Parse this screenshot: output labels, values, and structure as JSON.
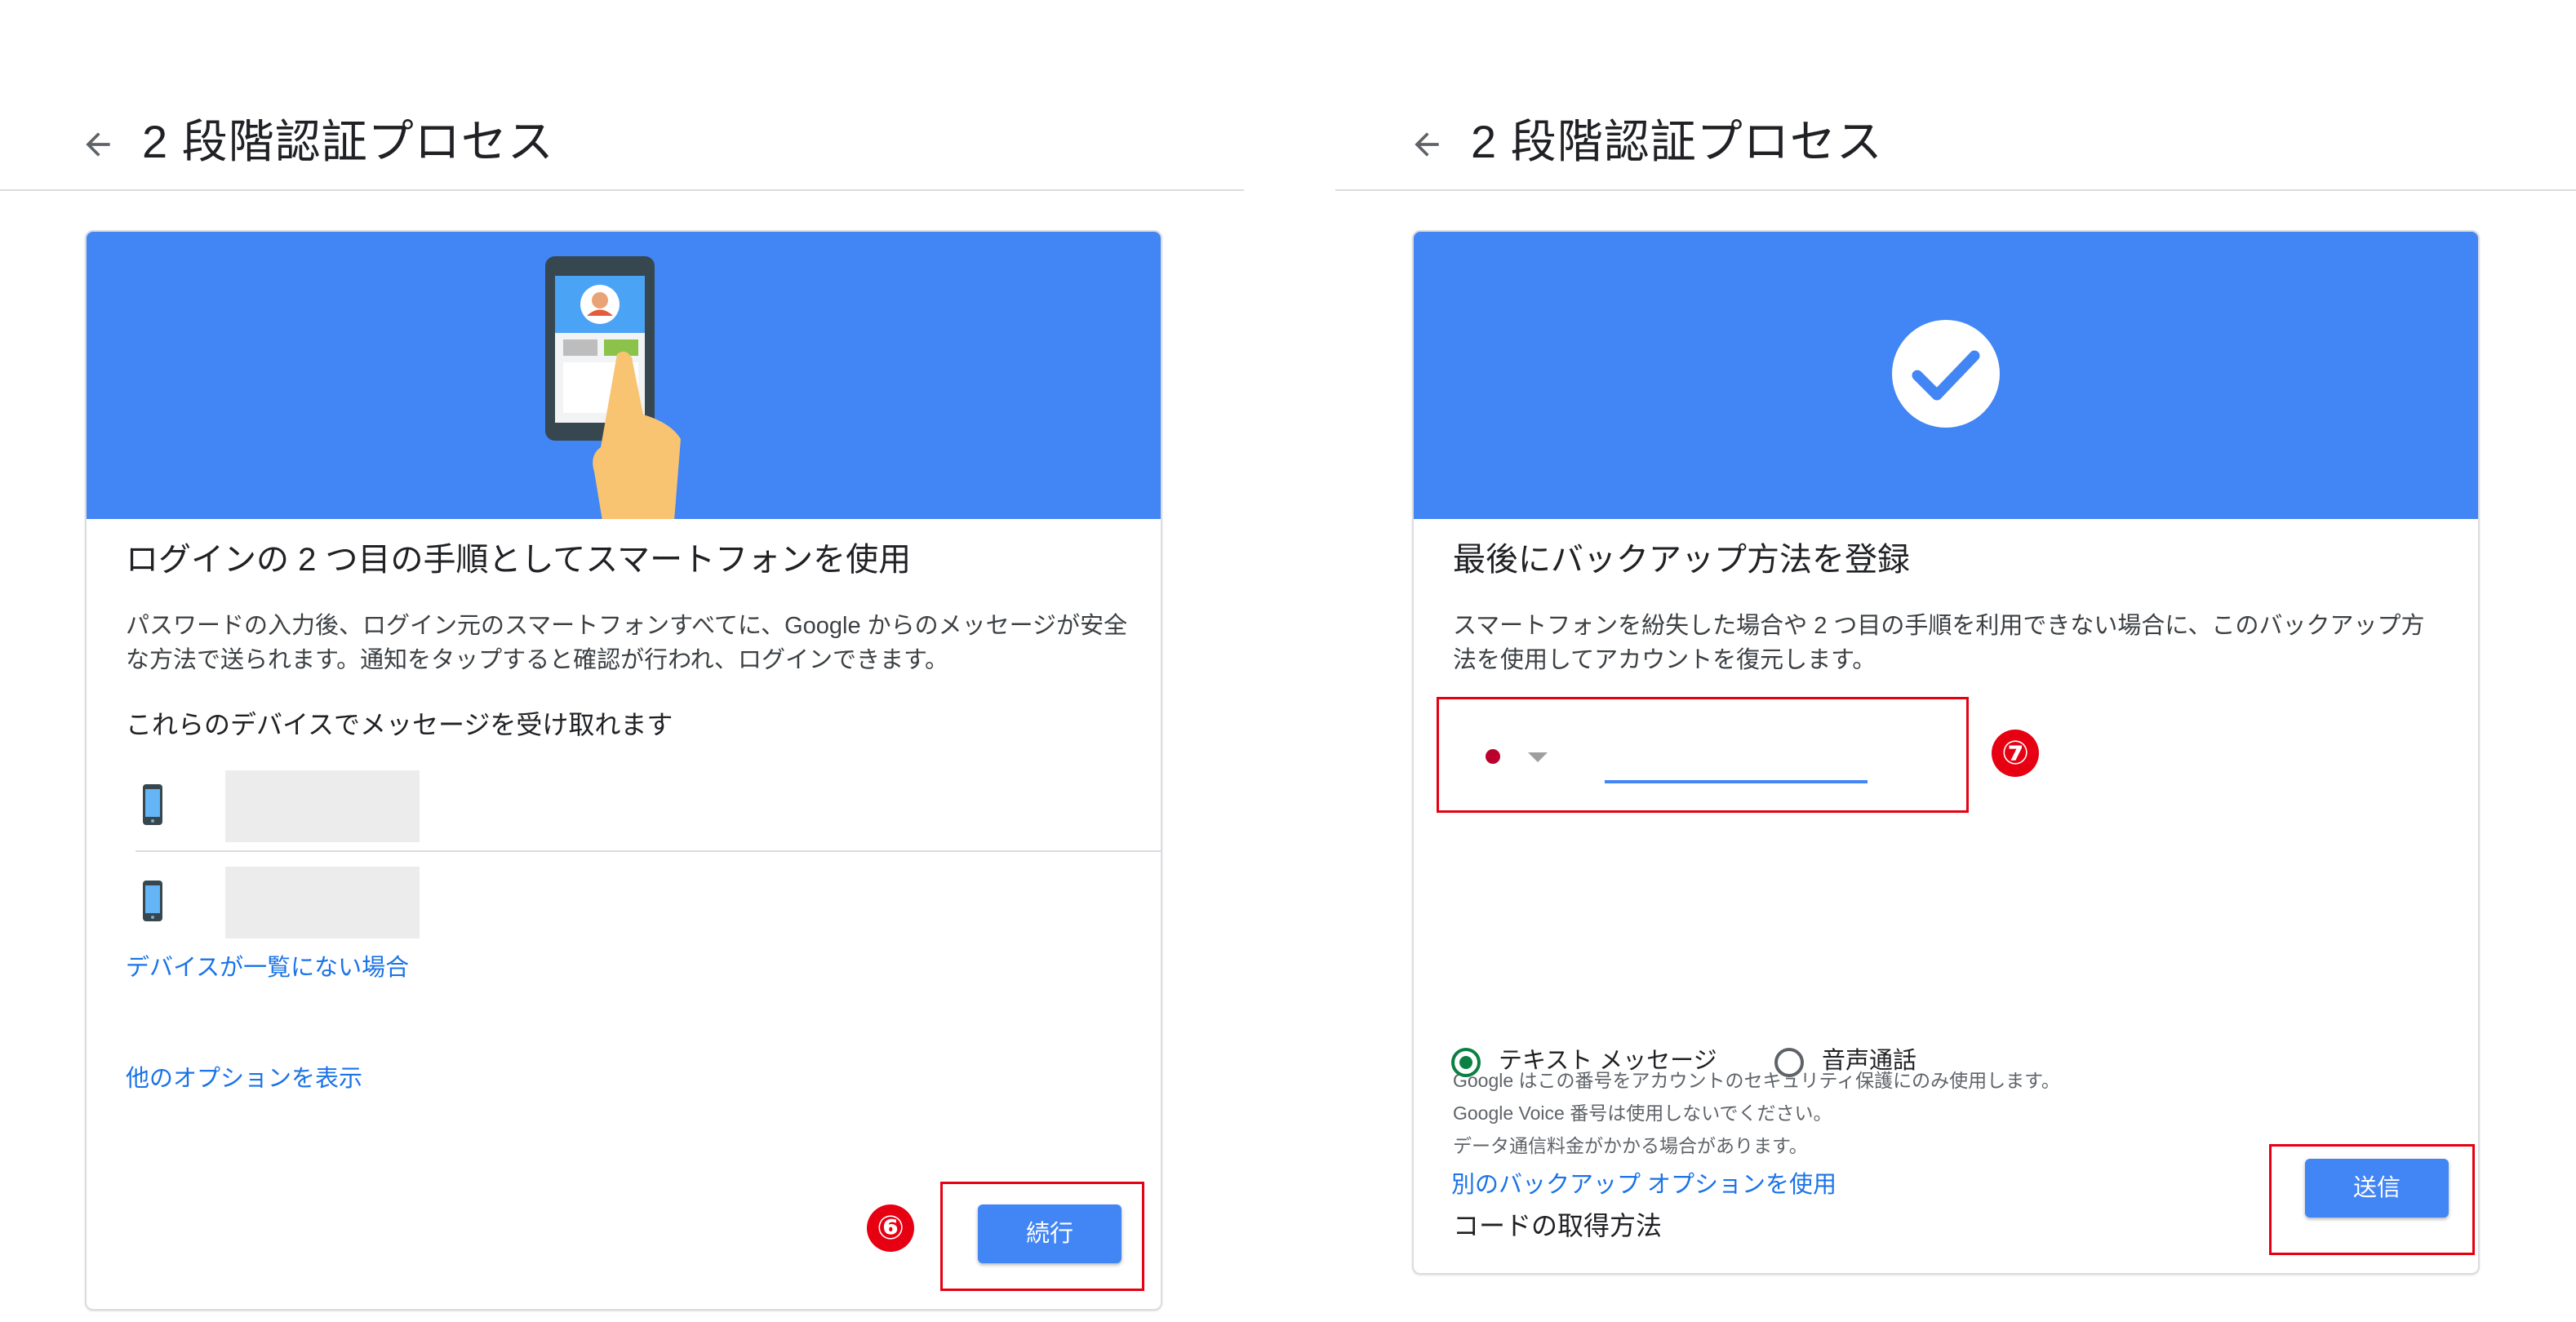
{
  "step6": {
    "header": {
      "title": "2 段階認証プロセス"
    },
    "card": {
      "title": "ログインの 2 つ目の手順としてスマートフォンを使用",
      "description": "パスワードの入力後、ログイン元のスマートフォンすべてに、Google からのメッセージが安全な方法で送られます。通知をタップすると確認が行われ、ログインできます。",
      "devices_heading": "これらのデバイスでメッセージを受け取れます",
      "devices": [
        {
          "icon": "smartphone-icon"
        },
        {
          "icon": "smartphone-icon"
        }
      ],
      "device_missing_link": "デバイスが一覧にない場合",
      "more_options_link": "他のオプションを表示",
      "continue_button": "続行"
    },
    "annotation": "⑥"
  },
  "step7": {
    "header": {
      "title": "2 段階認証プロセス"
    },
    "card": {
      "title": "最後にバックアップ方法を登録",
      "description": "スマートフォンを紛失した場合や 2 つ目の手順を利用できない場合に、このバックアップ方法を使用してアカウントを復元します。",
      "phone_input": {
        "value": "",
        "country": "jp-flag"
      },
      "notes": [
        "Google はこの番号をアカウントのセキュリティ保護にのみ使用します。",
        "Google Voice 番号は使用しないでください。",
        "データ通信料金がかかる場合があります。"
      ],
      "code_method_heading": "コードの取得方法",
      "options": [
        {
          "label": "テキスト メッセージ",
          "selected": true
        },
        {
          "label": "音声通話",
          "selected": false
        }
      ],
      "other_backup_link": "別のバックアップ オプションを使用",
      "send_button": "送信"
    },
    "annotation": "⑦"
  },
  "colors": {
    "accent": "#4285f4",
    "link": "#1a73e8",
    "annotation_red": "#e60012",
    "radio_selected": "#0b8043"
  }
}
